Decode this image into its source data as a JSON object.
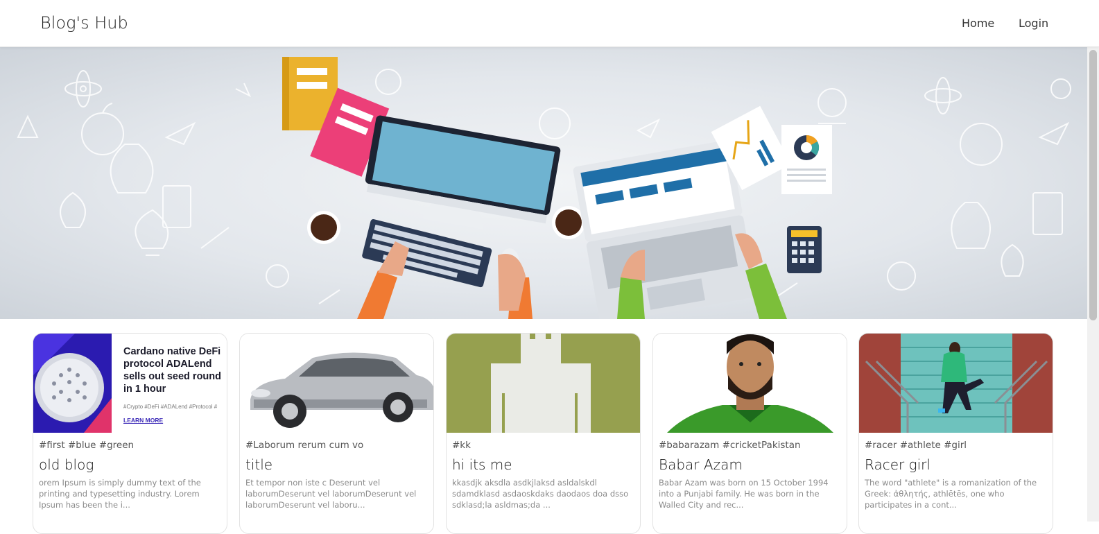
{
  "navbar": {
    "brand": "Blog's Hub",
    "links": [
      {
        "label": "Home"
      },
      {
        "label": "Login"
      }
    ]
  },
  "hero": {
    "image": "office-workspace-illustration",
    "colors": {
      "background": "#dfe4ea",
      "keyboard": "#2b3a55",
      "screen": "#6fb3d0",
      "sleeve_left": "#f07a32",
      "sleeve_right": "#7cbf3a"
    }
  },
  "posts": [
    {
      "image": "cardano-ad-thumbnail",
      "ad": {
        "headline": "Cardano native DeFi protocol ADALend sells out seed round in 1 hour",
        "tags": "#Crypto #DeFi #ADALend #Protocol #",
        "cta": "LEARN MORE"
      },
      "tags": "#first #blue #green",
      "title": "old blog",
      "excerpt": "orem Ipsum is simply dummy text of the printing and typesetting industry. Lorem Ipsum has been the i..."
    },
    {
      "image": "silver-sedan-car",
      "tags": "#Laborum rerum cum vo",
      "title": "title",
      "excerpt": "Et tempor non iste c Deserunt vel laborumDeserunt vel laborumDeserunt vel laborumDeserunt vel laboru..."
    },
    {
      "image": "pixel-figure-on-olive",
      "tags": "#kk",
      "title": "hi its me",
      "excerpt": "kkasdjk aksdla asdkjlaksd asldalskdl sdamdklasd asdaoskdaks daodaos doa dsso sdklasd;la asldmas;da ..."
    },
    {
      "image": "cricketer-portrait",
      "tags": "#babarazam #cricketPakistan",
      "title": "Babar Azam",
      "excerpt": "Babar Azam was born on 15 October 1994 into a Punjabi family. He was born in the Walled City and rec..."
    },
    {
      "image": "athlete-on-stairs",
      "tags": "#racer #athlete #girl",
      "title": "Racer girl",
      "excerpt": "The word \"athlete\" is a romanization of the Greek: ἀθλητής, athlētēs, one who participates in a cont..."
    }
  ]
}
